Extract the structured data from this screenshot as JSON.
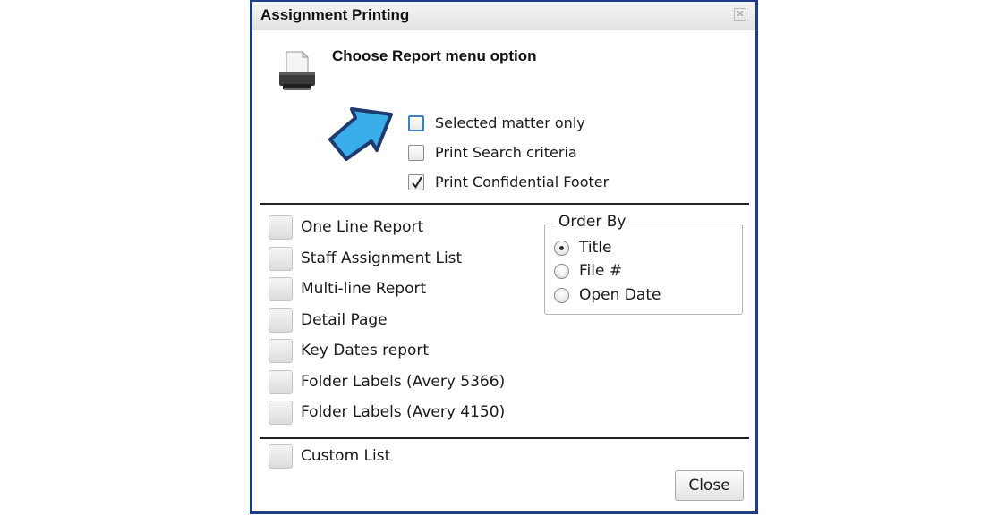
{
  "window": {
    "title": "Assignment Printing"
  },
  "header": {
    "heading": "Choose Report menu option"
  },
  "icons": {
    "printer": "printer-icon",
    "callout": "blue-arrow-icon",
    "close": "close-icon",
    "check": "checkmark-icon"
  },
  "colors": {
    "window_border": "#1d3f8a",
    "arrow_fill": "#3aaee8",
    "arrow_stroke": "#1f3a6e"
  },
  "options": [
    {
      "label": "Selected matter only",
      "checked": false
    },
    {
      "label": "Print Search criteria",
      "checked": false
    },
    {
      "label": "Print Confidential Footer",
      "checked": true
    }
  ],
  "reports": [
    {
      "label": "One Line Report"
    },
    {
      "label": "Staff Assignment List"
    },
    {
      "label": "Multi-line Report"
    },
    {
      "label": "Detail Page"
    },
    {
      "label": "Key Dates report"
    },
    {
      "label": "Folder Labels (Avery 5366)"
    },
    {
      "label": "Folder Labels (Avery 4150)"
    }
  ],
  "order_by": {
    "title": "Order By",
    "options": [
      {
        "label": "Title",
        "selected": true
      },
      {
        "label": "File #",
        "selected": false
      },
      {
        "label": "Open Date",
        "selected": false
      }
    ]
  },
  "custom": {
    "label": "Custom List"
  },
  "buttons": {
    "close": "Close"
  }
}
